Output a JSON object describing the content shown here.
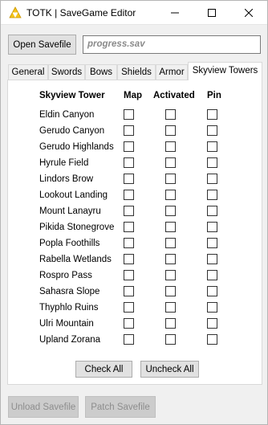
{
  "window": {
    "title": "TOTK | SaveGame Editor"
  },
  "toolbar": {
    "open_label": "Open Savefile",
    "savefile_value": "progress.sav"
  },
  "tabs": [
    {
      "label": "General"
    },
    {
      "label": "Swords"
    },
    {
      "label": "Bows"
    },
    {
      "label": "Shields"
    },
    {
      "label": "Armor"
    },
    {
      "label": "Skyview Towers",
      "active": true
    }
  ],
  "towers": {
    "headers": {
      "name": "Skyview Tower",
      "map": "Map",
      "activated": "Activated",
      "pin": "Pin"
    },
    "rows": [
      {
        "name": "Eldin Canyon",
        "map": false,
        "activated": false,
        "pin": false
      },
      {
        "name": "Gerudo Canyon",
        "map": false,
        "activated": false,
        "pin": false
      },
      {
        "name": "Gerudo Highlands",
        "map": false,
        "activated": false,
        "pin": false
      },
      {
        "name": "Hyrule Field",
        "map": false,
        "activated": false,
        "pin": false
      },
      {
        "name": "Lindors Brow",
        "map": false,
        "activated": false,
        "pin": false
      },
      {
        "name": "Lookout Landing",
        "map": false,
        "activated": false,
        "pin": false
      },
      {
        "name": "Mount Lanayru",
        "map": false,
        "activated": false,
        "pin": false
      },
      {
        "name": "Pikida Stonegrove",
        "map": false,
        "activated": false,
        "pin": false
      },
      {
        "name": "Popla Foothills",
        "map": false,
        "activated": false,
        "pin": false
      },
      {
        "name": "Rabella Wetlands",
        "map": false,
        "activated": false,
        "pin": false
      },
      {
        "name": "Rospro Pass",
        "map": false,
        "activated": false,
        "pin": false
      },
      {
        "name": "Sahasra Slope",
        "map": false,
        "activated": false,
        "pin": false
      },
      {
        "name": "Thyphlo Ruins",
        "map": false,
        "activated": false,
        "pin": false
      },
      {
        "name": "Ulri Mountain",
        "map": false,
        "activated": false,
        "pin": false
      },
      {
        "name": "Upland Zorana",
        "map": false,
        "activated": false,
        "pin": false
      }
    ],
    "check_all_label": "Check All",
    "uncheck_all_label": "Uncheck All"
  },
  "footer": {
    "unload_label": "Unload Savefile",
    "patch_label": "Patch Savefile"
  },
  "colors": {
    "window_bg": "#f0f0f0",
    "focus_border": "#0078d7",
    "icon_yellow": "#f5c518"
  },
  "icons": [
    "triforce-icon",
    "minimize-icon",
    "maximize-icon",
    "close-icon"
  ]
}
